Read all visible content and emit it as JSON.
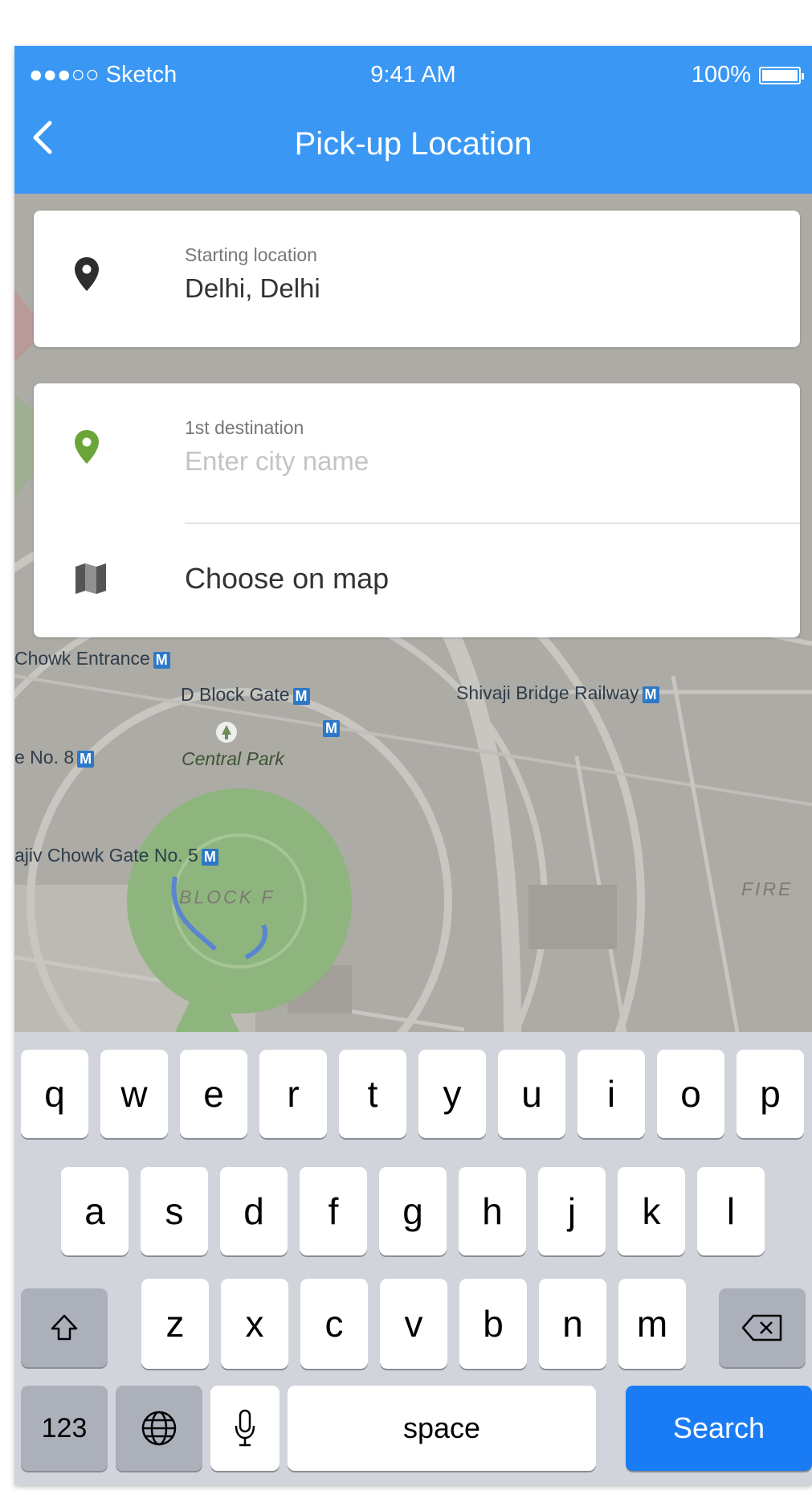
{
  "status_bar": {
    "carrier": "●●●○○ Sketch",
    "time": "9:41 AM",
    "battery": "100%"
  },
  "header": {
    "title": "Pick-up Location"
  },
  "start": {
    "label": "Starting location",
    "value": "Delhi, Delhi"
  },
  "destination": {
    "label": "1st destination",
    "placeholder": "Enter city name"
  },
  "choose_on_map": "Choose on map",
  "map_labels": {
    "chowk_entrance": "Chowk Entrance",
    "d_block_gate": "D Block Gate",
    "shivaji_bridge": "Shivaji Bridge Railway",
    "gate_no_8": "e No. 8",
    "central_park": "Central Park",
    "rajiv_chowk_gate_5": "ajiv Chowk Gate No. 5",
    "block_f": "BLOCK F",
    "fire": "FIRE",
    "metro": "M"
  },
  "keyboard": {
    "row1": [
      "q",
      "w",
      "e",
      "r",
      "t",
      "y",
      "u",
      "i",
      "o",
      "p"
    ],
    "row2": [
      "a",
      "s",
      "d",
      "f",
      "g",
      "h",
      "j",
      "k",
      "l"
    ],
    "row3": [
      "z",
      "x",
      "c",
      "v",
      "b",
      "n",
      "m"
    ],
    "numbers": "123",
    "space": "space",
    "search": "Search"
  },
  "colors": {
    "header": "#3a98f4",
    "map": "#adaba5",
    "park": "#8fb57e",
    "destination_pin": "#6aa53a",
    "search_key": "#1a7cf5"
  }
}
